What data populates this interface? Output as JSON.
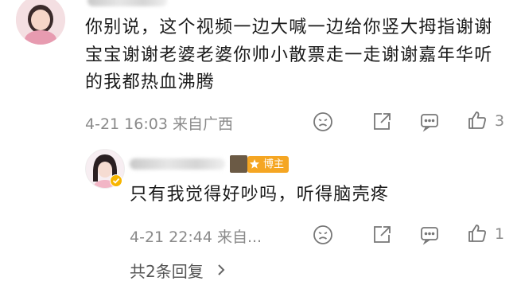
{
  "comment": {
    "text": "你别说，这个视频一边大喊一边给你竖大拇指谢谢宝宝谢谢老婆老婆你帅小散票走一走谢谢嘉年华听的我都热血沸腾",
    "time": "4-21 16:03",
    "location": "来自广西",
    "like_count": "3"
  },
  "reply": {
    "badge": "博主",
    "text": "只有我觉得好吵吗，听得脑壳疼",
    "time": "4-21 22:44",
    "location": "来自...",
    "like_count": "1"
  },
  "more_replies": "共2条回复",
  "colors": {
    "accent_badge": "#f5a623",
    "meta_gray": "#8a8a8a",
    "text": "#1a1a1a"
  }
}
